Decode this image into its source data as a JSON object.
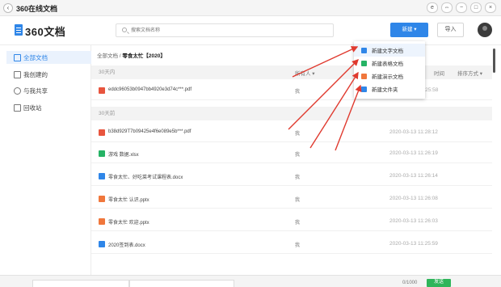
{
  "window": {
    "back_icon": "‹",
    "title": "360在线文档",
    "controls": [
      "e",
      "⇔",
      "−",
      "□",
      "×"
    ]
  },
  "header": {
    "logo_text": "360文档",
    "search_placeholder": "搜索文档名称",
    "new_label": "新建 ▾",
    "import_label": "导入"
  },
  "sidebar": {
    "items": [
      {
        "label": "全部文档",
        "icon": "all-docs-icon",
        "active": true
      },
      {
        "label": "我创建的",
        "icon": "my-docs-icon",
        "active": false
      },
      {
        "label": "与我共享",
        "icon": "shared-icon",
        "active": false
      },
      {
        "label": "回收站",
        "icon": "trash-icon",
        "active": false
      }
    ]
  },
  "main": {
    "breadcrumb_root": "全部文档",
    "breadcrumb_sep": " / ",
    "breadcrumb_current": "零食太忙【2020】",
    "col_owner": "所有人 ▾",
    "col_time": "时间",
    "col_sort": "排序方式 ▾",
    "section_30_in": "30天内",
    "section_30_ago": "30天前",
    "files": [
      {
        "name": "eddc96053b0947bb4920e3d74c***.pdf",
        "owner": "我",
        "time": "2020-03-13 10:25:58",
        "icon": "pdf-icon",
        "color": "#e8553e"
      },
      {
        "name": "b38d929T7b09425e4f6e089e5b***.pdf",
        "owner": "我",
        "time": "2020-03-13 11:28:12",
        "icon": "pdf-icon",
        "color": "#e8553e"
      },
      {
        "name": "游戏 数据.xlsx",
        "owner": "我",
        "time": "2020-03-13 11:26:19",
        "icon": "sheet-icon",
        "color": "#25b365"
      },
      {
        "name": "零食太忙、好吃菜考试课程表.docx",
        "owner": "我",
        "time": "2020-03-13 11:26:14",
        "icon": "doc-icon",
        "color": "#2f86e8"
      },
      {
        "name": "零食太忙 认识.pptx",
        "owner": "我",
        "time": "2020-03-13 11:26:08",
        "icon": "ppt-icon",
        "color": "#f0773c"
      },
      {
        "name": "零食太忙 欢迎.pptx",
        "owner": "我",
        "time": "2020-03-13 11:26:03",
        "icon": "ppt-icon",
        "color": "#f0773c"
      },
      {
        "name": "2020签到表.docx",
        "owner": "我",
        "time": "2020-03-13 11:25:59",
        "icon": "doc-icon",
        "color": "#2f86e8"
      }
    ]
  },
  "dropdown": {
    "items": [
      {
        "label": "新建文字文档",
        "icon": "text-doc-icon",
        "color": "#2f86e8"
      },
      {
        "label": "新建表格文档",
        "icon": "sheet-doc-icon",
        "color": "#25b365"
      },
      {
        "label": "新建演示文档",
        "icon": "slide-doc-icon",
        "color": "#f0773c"
      },
      {
        "label": "新建文件夹",
        "icon": "folder-icon",
        "color": "#2f86e8"
      }
    ]
  },
  "footer": {
    "counter": "0/1000",
    "send_label": "发送"
  },
  "colors": {
    "accent": "#2f86e8",
    "arrow": "#e03a2f"
  }
}
